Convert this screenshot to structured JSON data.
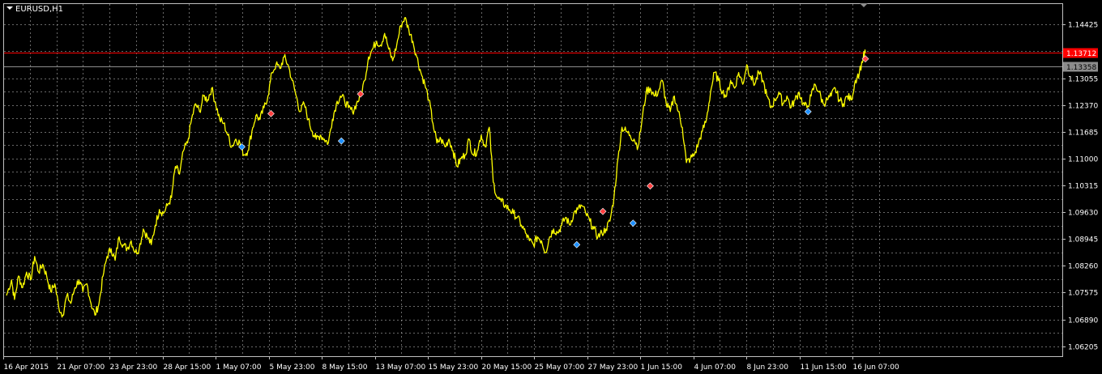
{
  "window": {
    "symbol_title": "EURUSD,H1"
  },
  "colors": {
    "background": "#000000",
    "grid": "#c0c0c0",
    "price_line": "#ffff00",
    "bid_line": "#8c8c8c",
    "ask_line": "#ff0000",
    "buy_marker": "#1e90ff",
    "sell_marker": "#ff4040",
    "axis_text": "#ffffff"
  },
  "chart_data": {
    "type": "line",
    "title": "EURUSD,H1",
    "xlabel": "",
    "ylabel": "",
    "ylim": [
      1.0595,
      1.1495
    ],
    "grid": true,
    "x_ticks": [
      "16 Apr 2015",
      "21 Apr 07:00",
      "23 Apr 23:00",
      "28 Apr 15:00",
      "1 May 07:00",
      "5 May 23:00",
      "8 May 15:00",
      "13 May 07:00",
      "15 May 23:00",
      "20 May 15:00",
      "25 May 07:00",
      "27 May 23:00",
      "1 Jun 15:00",
      "4 Jun 07:00",
      "8 Jun 23:00",
      "11 Jun 15:00",
      "16 Jun 07:00"
    ],
    "y_ticks": [
      "1.14425",
      "1.13055",
      "1.12370",
      "1.11685",
      "1.11000",
      "1.10315",
      "1.09630",
      "1.08945",
      "1.08260",
      "1.07575",
      "1.06890",
      "1.06205"
    ],
    "current_price_tags": [
      {
        "label": "1.13712",
        "value": 1.13712,
        "color": "#ff0000",
        "text_color": "#ffffff"
      },
      {
        "label": "1.13358",
        "value": 1.13358,
        "color": "#8c8c8c",
        "text_color": "#000000"
      }
    ],
    "x_range": [
      0,
      1000
    ],
    "series": [
      {
        "color": "#ffff00",
        "points": [
          [
            0,
            1.075
          ],
          [
            5,
            1.079
          ],
          [
            8,
            1.074
          ],
          [
            12,
            1.08
          ],
          [
            16,
            1.077
          ],
          [
            20,
            1.081
          ],
          [
            24,
            1.079
          ],
          [
            28,
            1.085
          ],
          [
            32,
            1.081
          ],
          [
            36,
            1.083
          ],
          [
            40,
            1.08
          ],
          [
            44,
            1.076
          ],
          [
            48,
            1.078
          ],
          [
            52,
            1.072
          ],
          [
            56,
            1.07
          ],
          [
            60,
            1.075
          ],
          [
            64,
            1.073
          ],
          [
            68,
            1.077
          ],
          [
            72,
            1.079
          ],
          [
            76,
            1.076
          ],
          [
            80,
            1.078
          ],
          [
            84,
            1.073
          ],
          [
            88,
            1.07
          ],
          [
            92,
            1.073
          ],
          [
            96,
            1.08
          ],
          [
            100,
            1.085
          ],
          [
            104,
            1.087
          ],
          [
            108,
            1.084
          ],
          [
            112,
            1.09
          ],
          [
            116,
            1.088
          ],
          [
            120,
            1.087
          ],
          [
            124,
            1.089
          ],
          [
            128,
            1.086
          ],
          [
            132,
            1.087
          ],
          [
            136,
            1.092
          ],
          [
            140,
            1.09
          ],
          [
            144,
            1.088
          ],
          [
            148,
            1.093
          ],
          [
            152,
            1.097
          ],
          [
            156,
            1.096
          ],
          [
            160,
            1.098
          ],
          [
            164,
            1.1
          ],
          [
            168,
            1.108
          ],
          [
            172,
            1.106
          ],
          [
            176,
            1.112
          ],
          [
            180,
            1.114
          ],
          [
            184,
            1.12
          ],
          [
            188,
            1.124
          ],
          [
            192,
            1.122
          ],
          [
            196,
            1.126
          ],
          [
            200,
            1.125
          ],
          [
            204,
            1.128
          ],
          [
            208,
            1.124
          ],
          [
            212,
            1.12
          ],
          [
            216,
            1.119
          ],
          [
            220,
            1.116
          ],
          [
            224,
            1.113
          ],
          [
            228,
            1.115
          ],
          [
            232,
            1.114
          ],
          [
            236,
            1.111
          ],
          [
            240,
            1.112
          ],
          [
            244,
            1.117
          ],
          [
            248,
            1.121
          ],
          [
            252,
            1.12
          ],
          [
            256,
            1.123
          ],
          [
            260,
            1.126
          ],
          [
            264,
            1.132
          ],
          [
            268,
            1.134
          ],
          [
            272,
            1.133
          ],
          [
            276,
            1.136
          ],
          [
            280,
            1.134
          ],
          [
            284,
            1.13
          ],
          [
            288,
            1.126
          ],
          [
            292,
            1.122
          ],
          [
            296,
            1.124
          ],
          [
            300,
            1.12
          ],
          [
            304,
            1.117
          ],
          [
            308,
            1.115
          ],
          [
            312,
            1.116
          ],
          [
            316,
            1.115
          ],
          [
            320,
            1.114
          ],
          [
            324,
            1.12
          ],
          [
            328,
            1.124
          ],
          [
            332,
            1.126
          ],
          [
            336,
            1.125
          ],
          [
            340,
            1.123
          ],
          [
            344,
            1.122
          ],
          [
            348,
            1.124
          ],
          [
            352,
            1.126
          ],
          [
            356,
            1.13
          ],
          [
            360,
            1.136
          ],
          [
            364,
            1.138
          ],
          [
            368,
            1.14
          ],
          [
            372,
            1.139
          ],
          [
            376,
            1.142
          ],
          [
            380,
            1.138
          ],
          [
            384,
            1.135
          ],
          [
            388,
            1.139
          ],
          [
            392,
            1.144
          ],
          [
            396,
            1.146
          ],
          [
            400,
            1.143
          ],
          [
            404,
            1.14
          ],
          [
            408,
            1.136
          ],
          [
            412,
            1.132
          ],
          [
            416,
            1.129
          ],
          [
            420,
            1.125
          ],
          [
            424,
            1.119
          ],
          [
            428,
            1.114
          ],
          [
            432,
            1.115
          ],
          [
            436,
            1.113
          ],
          [
            440,
            1.115
          ],
          [
            444,
            1.112
          ],
          [
            448,
            1.108
          ],
          [
            452,
            1.11
          ],
          [
            456,
            1.111
          ],
          [
            460,
            1.115
          ],
          [
            464,
            1.111
          ],
          [
            468,
            1.112
          ],
          [
            472,
            1.116
          ],
          [
            476,
            1.113
          ],
          [
            480,
            1.118
          ],
          [
            484,
            1.104
          ],
          [
            488,
            1.1
          ],
          [
            492,
            1.099
          ],
          [
            496,
            1.098
          ],
          [
            500,
            1.097
          ],
          [
            504,
            1.096
          ],
          [
            508,
            1.095
          ],
          [
            512,
            1.093
          ],
          [
            516,
            1.091
          ],
          [
            520,
            1.089
          ],
          [
            524,
            1.088
          ],
          [
            528,
            1.09
          ],
          [
            532,
            1.089
          ],
          [
            536,
            1.086
          ],
          [
            540,
            1.09
          ],
          [
            544,
            1.092
          ],
          [
            548,
            1.091
          ],
          [
            552,
            1.093
          ],
          [
            556,
            1.095
          ],
          [
            560,
            1.093
          ],
          [
            564,
            1.096
          ],
          [
            568,
            1.097
          ],
          [
            572,
            1.098
          ],
          [
            576,
            1.096
          ],
          [
            580,
            1.094
          ],
          [
            584,
            1.092
          ],
          [
            588,
            1.09
          ],
          [
            592,
            1.091
          ],
          [
            596,
            1.092
          ],
          [
            600,
            1.094
          ],
          [
            604,
            1.1
          ],
          [
            608,
            1.11
          ],
          [
            612,
            1.118
          ],
          [
            616,
            1.117
          ],
          [
            620,
            1.116
          ],
          [
            624,
            1.115
          ],
          [
            628,
            1.113
          ],
          [
            632,
            1.12
          ],
          [
            636,
            1.127
          ],
          [
            640,
            1.128
          ],
          [
            644,
            1.126
          ],
          [
            648,
            1.127
          ],
          [
            652,
            1.13
          ],
          [
            656,
            1.124
          ],
          [
            660,
            1.122
          ],
          [
            664,
            1.126
          ],
          [
            668,
            1.122
          ],
          [
            672,
            1.118
          ],
          [
            676,
            1.109
          ],
          [
            680,
            1.11
          ],
          [
            684,
            1.111
          ],
          [
            688,
            1.114
          ],
          [
            692,
            1.117
          ],
          [
            696,
            1.12
          ],
          [
            700,
            1.127
          ],
          [
            704,
            1.132
          ],
          [
            708,
            1.13
          ],
          [
            712,
            1.127
          ],
          [
            716,
            1.126
          ],
          [
            720,
            1.13
          ],
          [
            724,
            1.128
          ],
          [
            728,
            1.132
          ],
          [
            732,
            1.129
          ],
          [
            736,
            1.134
          ],
          [
            740,
            1.131
          ],
          [
            744,
            1.129
          ],
          [
            748,
            1.132
          ],
          [
            752,
            1.13
          ],
          [
            756,
            1.126
          ],
          [
            760,
            1.123
          ],
          [
            764,
            1.125
          ],
          [
            768,
            1.127
          ],
          [
            772,
            1.124
          ],
          [
            776,
            1.126
          ],
          [
            780,
            1.123
          ],
          [
            784,
            1.125
          ],
          [
            788,
            1.127
          ],
          [
            792,
            1.124
          ],
          [
            796,
            1.123
          ],
          [
            800,
            1.126
          ],
          [
            804,
            1.129
          ],
          [
            808,
            1.127
          ],
          [
            812,
            1.124
          ],
          [
            816,
            1.125
          ],
          [
            820,
            1.126
          ],
          [
            824,
            1.128
          ],
          [
            828,
            1.125
          ],
          [
            832,
            1.124
          ],
          [
            836,
            1.126
          ],
          [
            840,
            1.125
          ],
          [
            844,
            1.13
          ],
          [
            848,
            1.132
          ],
          [
            852,
            1.136
          ],
          [
            854,
            1.1371
          ]
        ]
      }
    ],
    "trade_markers": [
      {
        "x": 234,
        "y": 1.113,
        "side": "buy"
      },
      {
        "x": 263,
        "y": 1.1215,
        "side": "sell"
      },
      {
        "x": 333,
        "y": 1.1145,
        "side": "buy"
      },
      {
        "x": 352,
        "y": 1.1265,
        "side": "sell"
      },
      {
        "x": 567,
        "y": 1.088,
        "side": "buy"
      },
      {
        "x": 593,
        "y": 1.0965,
        "side": "sell"
      },
      {
        "x": 623,
        "y": 1.0935,
        "side": "buy"
      },
      {
        "x": 640,
        "y": 1.103,
        "side": "sell"
      },
      {
        "x": 797,
        "y": 1.122,
        "side": "buy"
      },
      {
        "x": 854,
        "y": 1.1355,
        "side": "sell"
      }
    ]
  }
}
